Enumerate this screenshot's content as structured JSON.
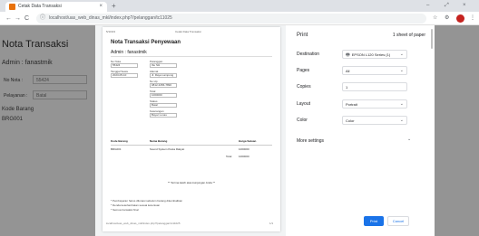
{
  "browser": {
    "tab_title": "Cetak Data Transaksi",
    "tab_close": "×",
    "new_tab": "+",
    "url": "localhost/uas_web_dinas_mkl/index.php?/pelanggan/tc11025",
    "nav_back": "←",
    "nav_forward": "→",
    "nav_reload": "C",
    "win_min": "–",
    "win_max": "⤢",
    "win_close": "×",
    "star": "☆",
    "ext_icon": "⚙",
    "menu": "⋮"
  },
  "underlying_page": {
    "title": "Nota Transaksi",
    "admin": "Admin : fanastmik",
    "no_nota_label": "No Nota :",
    "no_nota_value": "55424",
    "pelayanan_label": "Pelayanan :",
    "pelayanan_value": "Batal",
    "kode_barang_label": "Kode Barang",
    "kode_barang_value": "BRG001"
  },
  "preview": {
    "header_left": "5/10/23",
    "header_center": "Cetak Data Transaksi",
    "title": "Nota Transaksi Penyewaan",
    "admin": "Admin : fanastmik",
    "f_no_nota_label": "No Nota",
    "f_no_nota_value": "55424",
    "f_pelanggan_label": "Pelanggan",
    "f_pelanggan_value": "Ibu Siti",
    "f_tgl_label": "Tanggal Sewa",
    "f_tgl_value": "2023-05-10",
    "f_alamat_label": "Alamat",
    "f_alamat_value": "Jl. Raya Lampung",
    "f_hp_label": "No Hp",
    "f_hp_value": "0812-3456-7890",
    "f_total_label": "Total",
    "f_total_value": "1000000",
    "f_status_label": "Status",
    "f_status_value": "Batal",
    "f_ket_label": "Keterangan",
    "f_ket_value": "Bayar Lunas",
    "th_kode": "Kode Barang",
    "th_nama": "Nama Barang",
    "th_harga": "Harga Satuan",
    "td_kode": "BRG001",
    "td_nama": "Sound System Pesta Rakyat",
    "td_harga": "1000000",
    "total_label": "Total",
    "total_value": "1000000",
    "thanks": "** Terima kasih atas kunjungan Anda **",
    "note1": "* Pembayaran harus dilunasi sebelum barang dikembalikan",
    "note2": "* Denda keterlambatan sesuai ketentuan",
    "note3": "* Semua transaksi final",
    "footer_left": "localhost/uas_web_dinas_mkl/index.php?/pelanggan/tc11025",
    "footer_right": "1/1"
  },
  "settings": {
    "title": "Print",
    "sheets": "1 sheet of paper",
    "destination_label": "Destination",
    "destination_value": "EPSON L120 Series (1)",
    "pages_label": "Pages",
    "pages_value": "All",
    "copies_label": "Copies",
    "copies_value": "1",
    "layout_label": "Layout",
    "layout_value": "Portrait",
    "color_label": "Color",
    "color_value": "Color",
    "more_label": "More settings",
    "print_button": "Print",
    "cancel_button": "Cancel",
    "caret": "⌄"
  }
}
